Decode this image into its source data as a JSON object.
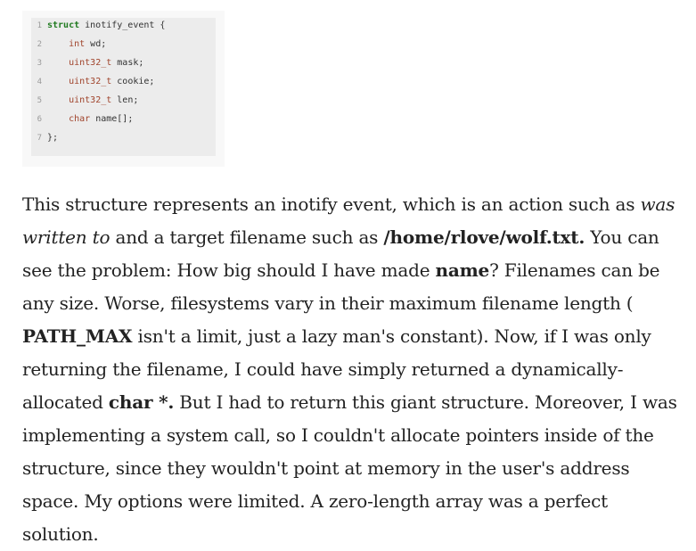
{
  "code": {
    "lines": [
      {
        "num": "1",
        "kw": "struct",
        "rest": " inotify_event {"
      },
      {
        "num": "2",
        "indent": "    ",
        "type": "int",
        "rest": " wd;"
      },
      {
        "num": "3",
        "indent": "    ",
        "type": "uint32_t",
        "rest": " mask;"
      },
      {
        "num": "4",
        "indent": "    ",
        "type": "uint32_t",
        "rest": " cookie;"
      },
      {
        "num": "5",
        "indent": "    ",
        "type": "uint32_t",
        "rest": " len;"
      },
      {
        "num": "6",
        "indent": "    ",
        "type": "char",
        "rest": " name[];"
      },
      {
        "num": "7",
        "rest": "};"
      }
    ]
  },
  "paragraph": {
    "t1": "This structure represents an inotify event, which is an action such as ",
    "em1": "was written to",
    "t2": " and a target filename such as ",
    "b1": "/home/rlove/wolf.txt.",
    "t3": " You can see the problem: How big should I have made ",
    "b2": "name",
    "t4": "? Filenames can be any size. Worse, filesystems vary in their maximum filename length ( ",
    "b3": "PATH_MAX",
    "t5": " isn't a limit, just a lazy man's constant). Now, if I was only returning the filename, I could have simply returned a dynamically-allocated ",
    "b4": "char *.",
    "t6": " But I had to return this giant structure. Moreover, I was implementing a system call, so I couldn't allocate pointers inside of the structure, since they wouldn't point at memory in the user's address space. My options were limited. A zero-length array was a perfect solution."
  }
}
